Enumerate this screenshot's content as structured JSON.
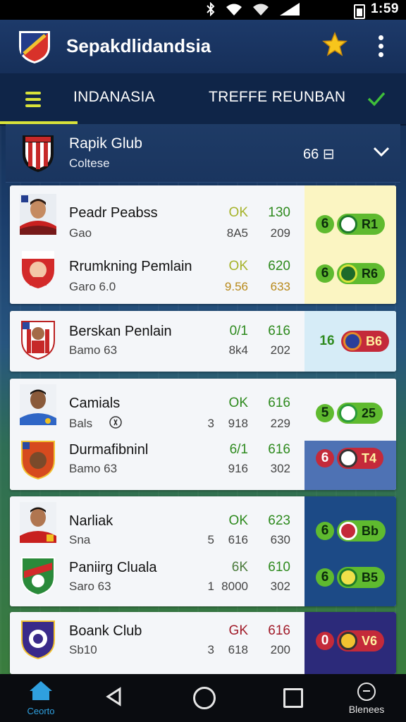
{
  "status_bar": {
    "time": "1:59"
  },
  "app_bar": {
    "title": "Sepakdlidandsia"
  },
  "tabs": {
    "first": "INDANASIA",
    "second": "TREFFE REUNBAN"
  },
  "club_header": {
    "name": "Rapik Glub",
    "subtitle": "Coltese",
    "count": "66 ⊟"
  },
  "cards": [
    {
      "rows": [
        {
          "name": "Peadr Peabss",
          "info": "Gao",
          "s1": "OK",
          "s2": "130",
          "s3": "8A5",
          "s4": "209",
          "badge_num": "6",
          "badge_label": "R1"
        },
        {
          "name": "Rrumkning Pemlain",
          "info": "Garo 6.0",
          "s1": "OK",
          "s2": "620",
          "s3": "9.56",
          "s4": "633",
          "badge_num": "6",
          "badge_label": "R6"
        }
      ]
    },
    {
      "rows": [
        {
          "name": "Berskan Penlain",
          "info": "Bamo 63",
          "s1": "0/1",
          "s2": "616",
          "s3": "8k4",
          "s4": "202",
          "badge_num": "16",
          "badge_label": "B6"
        }
      ]
    },
    {
      "rows": [
        {
          "name": "Camials",
          "info": "Bals",
          "extra": "3",
          "s1": "OK",
          "s2": "616",
          "s3": "918",
          "s4": "229",
          "badge_num": "5",
          "badge_label": "25"
        },
        {
          "name": "Durmafibninl",
          "info": "Bamo 63",
          "s1": "6/1",
          "s2": "616",
          "s3": "916",
          "s4": "302",
          "badge_num": "6",
          "badge_label": "T4"
        }
      ]
    },
    {
      "rows": [
        {
          "name": "Narliak",
          "info": "Sna",
          "extra": "5",
          "s1": "OK",
          "s2": "623",
          "s3": "616",
          "s4": "630",
          "badge_num": "6",
          "badge_label": "Bb"
        },
        {
          "name": "Paniirg Cluala",
          "info": "Saro 63",
          "extra": "1",
          "s1": "6K",
          "s2": "610",
          "s3": "8000",
          "s4": "302",
          "badge_num": "6",
          "badge_label": "B5"
        }
      ]
    },
    {
      "rows": [
        {
          "name": "Boank Club",
          "info": "Sb10",
          "extra": "3",
          "s1": "GK",
          "s2": "616",
          "s3": "618",
          "s4": "200",
          "badge_num": "0",
          "badge_label": "V6"
        }
      ]
    }
  ],
  "bottom_nav": {
    "home_label": "Ceorto",
    "more_label": "Blenees"
  },
  "colors": {
    "accent_yellow": "#d8e23a",
    "app_bar": "#1d3a6a",
    "tabs_bg": "#0f2548",
    "nav_home": "#2fa0df"
  }
}
